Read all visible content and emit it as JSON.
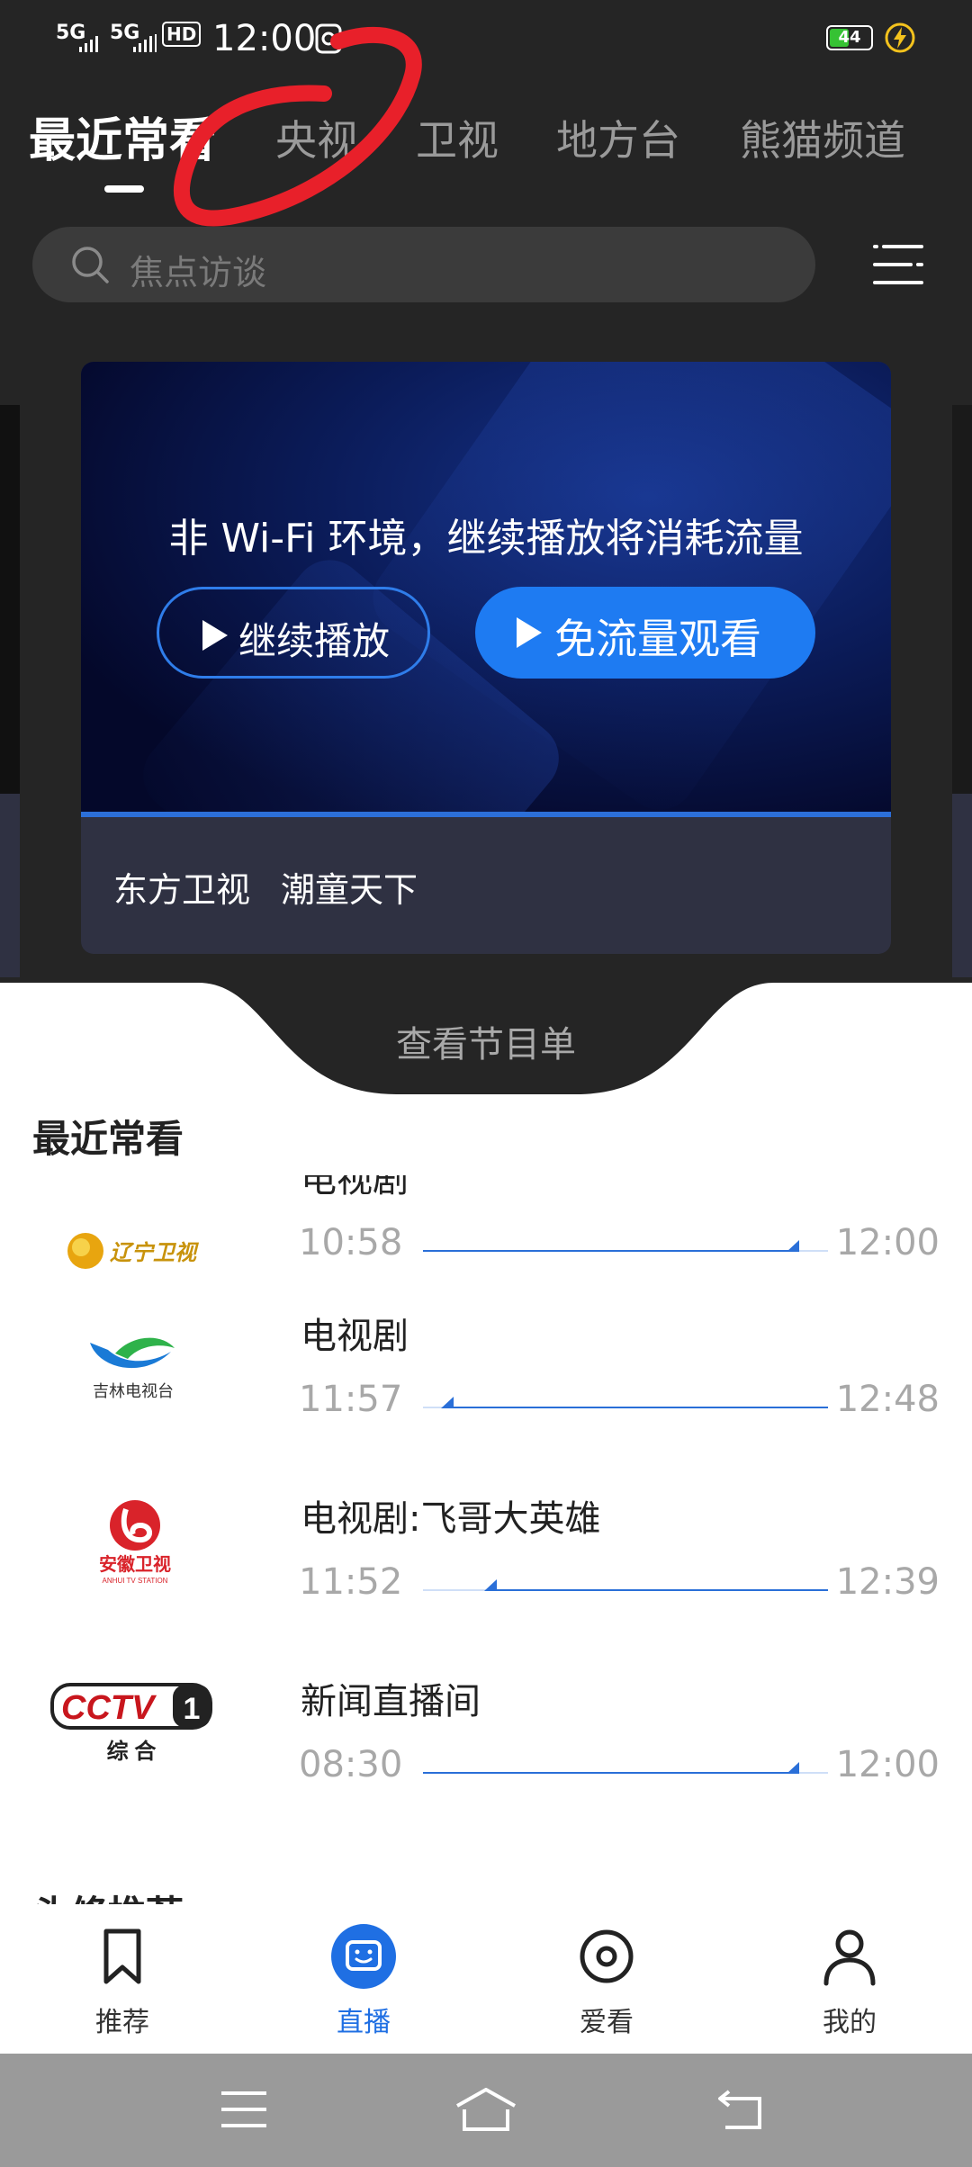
{
  "status_bar": {
    "signal1": "5G",
    "signal2": "5G",
    "hd": "HD",
    "time": "12:00",
    "battery": "44"
  },
  "tabs": [
    {
      "label": "最近常看",
      "active": true
    },
    {
      "label": "央视",
      "active": false
    },
    {
      "label": "卫视",
      "active": false
    },
    {
      "label": "地方台",
      "active": false
    },
    {
      "label": "熊猫频道",
      "active": false
    }
  ],
  "search": {
    "placeholder": "焦点访谈"
  },
  "player": {
    "message": "非 Wi-Fi 环境，继续播放将消耗流量",
    "continue_label": "继续播放",
    "free_label": "免流量观看",
    "channel": "东方卫视",
    "program": "潮童天下"
  },
  "schedule_label": "查看节目单",
  "recent": {
    "title": "最近常看",
    "items": [
      {
        "program": "电视剧",
        "start": "10:58",
        "end": "12:00",
        "progress": 0.93,
        "channel_logo": "辽宁卫视"
      },
      {
        "program": "电视剧",
        "start": "11:57",
        "end": "12:48",
        "progress": 0.06,
        "channel_logo": "吉林电视台"
      },
      {
        "program": "电视剧:飞哥大英雄",
        "start": "11:52",
        "end": "12:39",
        "progress": 0.17,
        "channel_logo": "安徽卫视"
      },
      {
        "program": "新闻直播间",
        "start": "08:30",
        "end": "12:00",
        "progress": 0.93,
        "channel_logo": "CCTV 1 综合"
      }
    ]
  },
  "next_section_title": "头條推荐",
  "bottom_nav": [
    {
      "label": "推荐",
      "icon": "bookmark-icon",
      "active": false
    },
    {
      "label": "直播",
      "icon": "live-tv-icon",
      "active": true
    },
    {
      "label": "爱看",
      "icon": "target-icon",
      "active": false
    },
    {
      "label": "我的",
      "icon": "person-icon",
      "active": false
    }
  ],
  "logos": {
    "liaoning": "辽宁卫视",
    "jilin": "吉林电视台",
    "anhui": "安徽卫视",
    "anhui_sub": "ANHUI TV STATION",
    "cctv": "CCTV",
    "cctv_num": "1",
    "cctv_sub": "综 合"
  },
  "colors": {
    "accent": "#1e7bf2",
    "dark_bg": "#252525",
    "annotation": "#e8202a"
  }
}
